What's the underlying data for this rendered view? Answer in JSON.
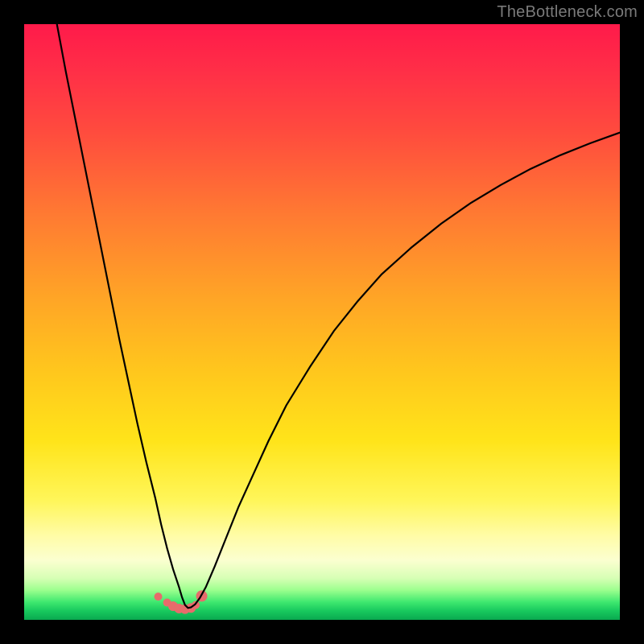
{
  "watermark": "TheBottleneck.com",
  "chart_data": {
    "type": "line",
    "title": "",
    "xlabel": "",
    "ylabel": "",
    "xlim": [
      0,
      100
    ],
    "ylim": [
      0,
      100
    ],
    "grid": false,
    "legend": false,
    "curve_minimum_x": 27,
    "series": [
      {
        "name": "bottleneck-curve",
        "x": [
          5.5,
          7,
          8.5,
          10,
          11.5,
          13,
          14.5,
          16,
          17.5,
          19,
          20.5,
          22,
          23,
          24,
          25,
          26,
          26.5,
          27,
          27.5,
          28,
          28.7,
          29.5,
          30.5,
          32,
          34,
          36,
          38.5,
          41,
          44,
          48,
          52,
          56,
          60,
          65,
          70,
          75,
          80,
          85,
          90,
          95,
          100
        ],
        "y": [
          100,
          92,
          84.5,
          77,
          69.5,
          62,
          54.5,
          47,
          40,
          33,
          26.5,
          20.5,
          16,
          12,
          8.5,
          5.5,
          3.8,
          2.5,
          2.0,
          2.1,
          2.6,
          3.7,
          5.5,
          9,
          14,
          19,
          24.5,
          30,
          36,
          42.5,
          48.5,
          53.5,
          58,
          62.5,
          66.5,
          70,
          73,
          75.7,
          78,
          80,
          81.8
        ]
      }
    ],
    "markers": {
      "name": "highlight-points",
      "color": "#e76b6b",
      "x": [
        22.5,
        24.0,
        25.0,
        26.0,
        27.0,
        28.0,
        28.8,
        29.8
      ],
      "y": [
        3.9,
        2.9,
        2.3,
        1.9,
        1.8,
        2.0,
        2.5,
        4.0
      ],
      "r": [
        5,
        5,
        6,
        6,
        6,
        6,
        5,
        7
      ]
    }
  }
}
